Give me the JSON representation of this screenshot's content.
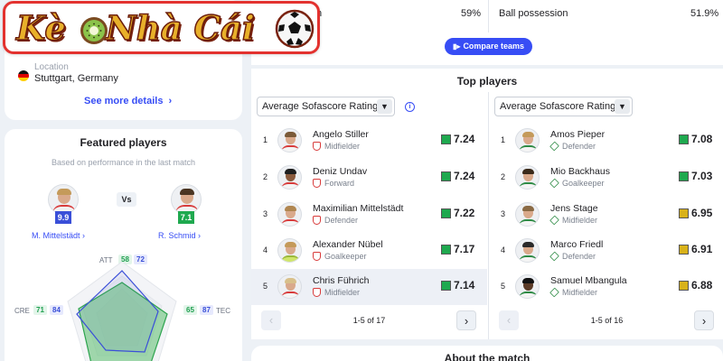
{
  "logo": {
    "text_part1": "Kè",
    "text_part2": "Nhà Cái",
    "kiwi_icon": "kiwi-icon",
    "ball_icon": "soccer-ball-icon"
  },
  "team_details": {
    "location_label": "Location",
    "location_value": "Stuttgart, Germany",
    "flag": "germany-flag",
    "see_more": "See more details",
    "see_more_chevron": "›"
  },
  "featured": {
    "title": "Featured players",
    "subtitle": "Based on performance in the last match",
    "vs_label": "Vs",
    "player_a": {
      "name": "M. Mittelstädt",
      "rating": "9.9",
      "rating_color": "#3a4fd8"
    },
    "player_b": {
      "name": "R. Schmid",
      "rating": "7.1",
      "rating_color": "#1fa94f"
    },
    "chevron": "›",
    "radar": {
      "labels": [
        {
          "key": "ATT",
          "a": "58",
          "b": "72"
        },
        {
          "key": "TEC",
          "a": "65",
          "b": "87"
        },
        {
          "key": "CRE",
          "a": "71",
          "b": "84"
        }
      ]
    }
  },
  "stats": {
    "partial_label": "n",
    "left_value": "59%",
    "right_label": "Ball possession",
    "right_value": "51.9%",
    "compare_button": "Compare teams",
    "compare_icon": "▮▸"
  },
  "top_players": {
    "title": "Top players",
    "info_icon": "i",
    "columns": [
      {
        "select_label": "Average Sofascore Rating",
        "caret": "▼",
        "players": [
          {
            "rank": "1",
            "name": "Angelo Stiller",
            "position": "Midfielder",
            "rating": "7.24",
            "color": "#1fa94f"
          },
          {
            "rank": "2",
            "name": "Deniz Undav",
            "position": "Forward",
            "rating": "7.24",
            "color": "#1fa94f"
          },
          {
            "rank": "3",
            "name": "Maximilian Mittelstädt",
            "position": "Defender",
            "rating": "7.22",
            "color": "#1fa94f"
          },
          {
            "rank": "4",
            "name": "Alexander Nübel",
            "position": "Goalkeeper",
            "rating": "7.17",
            "color": "#1fa94f"
          },
          {
            "rank": "5",
            "name": "Chris Führich",
            "position": "Midfielder",
            "rating": "7.14",
            "color": "#1fa94f"
          }
        ],
        "pager": {
          "prev": "‹",
          "next": "›",
          "info": "1-5 of 17"
        }
      },
      {
        "select_label": "Average Sofascore Rating",
        "caret": "▼",
        "players": [
          {
            "rank": "1",
            "name": "Amos Pieper",
            "position": "Defender",
            "rating": "7.08",
            "color": "#1fa94f"
          },
          {
            "rank": "2",
            "name": "Mio Backhaus",
            "position": "Goalkeeper",
            "rating": "7.03",
            "color": "#1fa94f"
          },
          {
            "rank": "3",
            "name": "Jens Stage",
            "position": "Midfielder",
            "rating": "6.95",
            "color": "#d8b21a"
          },
          {
            "rank": "4",
            "name": "Marco Friedl",
            "position": "Defender",
            "rating": "6.91",
            "color": "#d8b21a"
          },
          {
            "rank": "5",
            "name": "Samuel Mbangula",
            "position": "Midfielder",
            "rating": "6.88",
            "color": "#d8b21a"
          }
        ],
        "pager": {
          "prev": "‹",
          "next": "›",
          "info": "1-5 of 16"
        }
      }
    ]
  },
  "about": {
    "title": "About the match"
  },
  "colors": {
    "accent": "#374df5",
    "logo_border": "#e3322f",
    "good": "#1fa94f",
    "average": "#d8b21a"
  }
}
